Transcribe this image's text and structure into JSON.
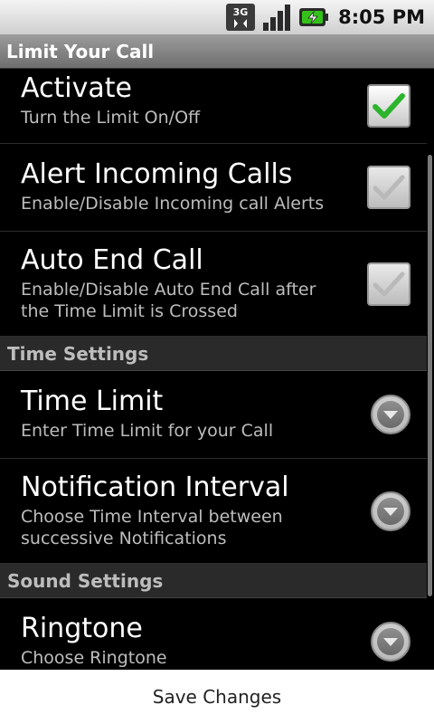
{
  "status_bar": {
    "network_label": "3G",
    "time": "8:05 PM"
  },
  "app": {
    "title": "Limit Your Call"
  },
  "preferences": {
    "activate": {
      "title": "Activate",
      "summary": "Turn the Limit On/Off",
      "checked": true,
      "enabled": true
    },
    "alert_incoming": {
      "title": "Alert Incoming Calls",
      "summary": "Enable/Disable Incoming call Alerts",
      "checked": true,
      "enabled": false
    },
    "auto_end": {
      "title": "Auto End Call",
      "summary": "Enable/Disable Auto End Call after the Time Limit is Crossed",
      "checked": true,
      "enabled": false
    },
    "time_settings_header": "Time Settings",
    "time_limit": {
      "title": "Time Limit",
      "summary": "Enter Time Limit for your Call"
    },
    "notification_interval": {
      "title": "Notification Interval",
      "summary": "Choose Time Interval between successive Notifications"
    },
    "sound_settings_header": "Sound Settings",
    "ringtone": {
      "title": "Ringtone",
      "summary": "Choose Ringtone"
    }
  },
  "footer": {
    "save_label": "Save Changes"
  },
  "colors": {
    "check_green": "#2db42d",
    "check_grey": "#b9b9b9",
    "battery_green": "#34c21a"
  }
}
